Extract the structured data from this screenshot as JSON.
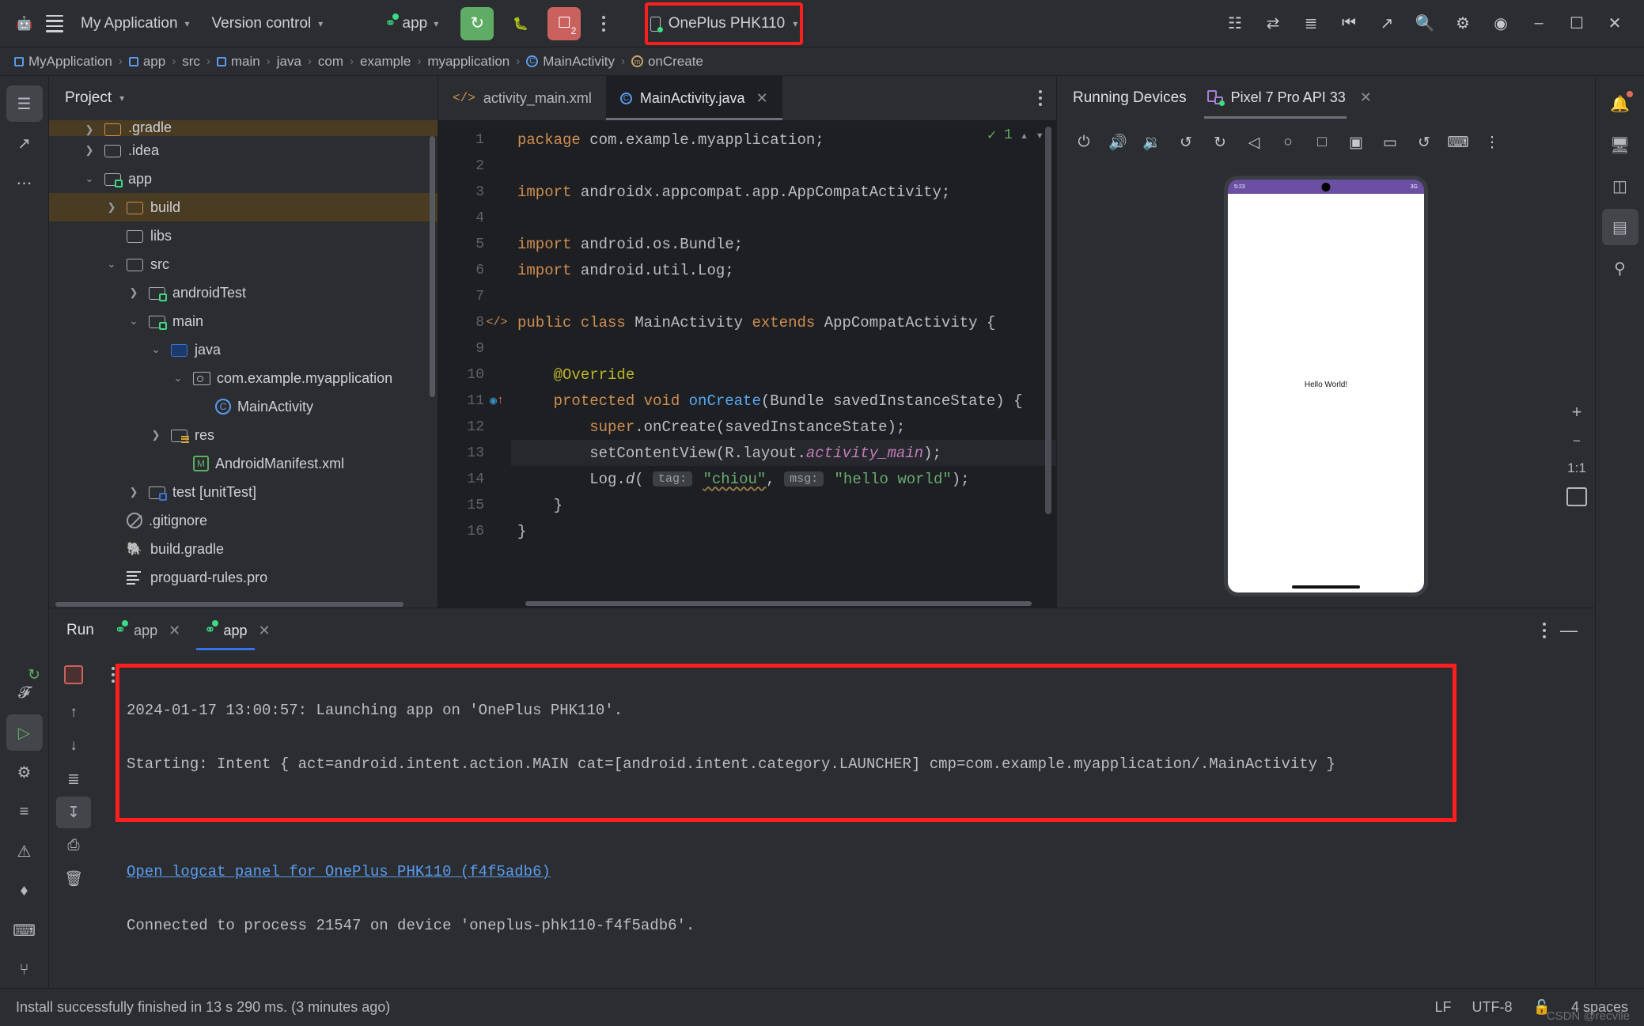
{
  "titlebar": {
    "app_icon": "android-icon",
    "menu_icon": "hamburger-menu-icon",
    "project_menu": "My Application",
    "vcs_menu": "Version control",
    "device_selector": "OnePlus PHK110",
    "run_config": "app",
    "run_button": "run-icon",
    "debug_button": "debug-icon",
    "device_manager_badge": "2",
    "highlight_color": "#ff1f1f",
    "win_minimize": "–",
    "win_maximize": "☐",
    "win_close": "✕"
  },
  "breadcrumb": [
    {
      "label": "MyApplication",
      "icon": "module-icon"
    },
    {
      "label": "app",
      "icon": "module-icon"
    },
    {
      "label": "src",
      "icon": "none"
    },
    {
      "label": "main",
      "icon": "module-icon"
    },
    {
      "label": "java",
      "icon": "none"
    },
    {
      "label": "com",
      "icon": "none"
    },
    {
      "label": "example",
      "icon": "none"
    },
    {
      "label": "myapplication",
      "icon": "none"
    },
    {
      "label": "MainActivity",
      "icon": "class-icon"
    },
    {
      "label": "onCreate",
      "icon": "method-icon"
    }
  ],
  "left_rail": [
    {
      "name": "project-tool-icon",
      "glyph": "☰",
      "selected": true
    },
    {
      "name": "commit-tool-icon",
      "glyph": "⎇",
      "selected": false
    },
    {
      "name": "more-tool-windows-icon",
      "glyph": "⋯",
      "selected": false
    }
  ],
  "project": {
    "title": "Project",
    "dropdown_icon": "chevron-down-icon",
    "tree": [
      {
        "label": ".gradle",
        "indent": 1,
        "arrow": "right",
        "icon": "folder-orange",
        "selected": true,
        "partial": true
      },
      {
        "label": ".idea",
        "indent": 1,
        "arrow": "right",
        "icon": "folder",
        "selected": false
      },
      {
        "label": "app",
        "indent": 1,
        "arrow": "down",
        "icon": "folder-module",
        "selected": false
      },
      {
        "label": "build",
        "indent": 2,
        "arrow": "right",
        "icon": "folder-orange",
        "selected": true
      },
      {
        "label": "libs",
        "indent": 2,
        "arrow": "none",
        "icon": "folder",
        "selected": false
      },
      {
        "label": "src",
        "indent": 2,
        "arrow": "down",
        "icon": "folder",
        "selected": false
      },
      {
        "label": "androidTest",
        "indent": 3,
        "arrow": "right",
        "icon": "folder-module",
        "selected": false
      },
      {
        "label": "main",
        "indent": 3,
        "arrow": "down",
        "icon": "folder-module",
        "selected": false
      },
      {
        "label": "java",
        "indent": 4,
        "arrow": "down",
        "icon": "folder-source",
        "selected": false
      },
      {
        "label": "com.example.myapplication",
        "indent": 5,
        "arrow": "down",
        "icon": "package",
        "selected": false
      },
      {
        "label": "MainActivity",
        "indent": 6,
        "arrow": "none",
        "icon": "class",
        "selected": false
      },
      {
        "label": "res",
        "indent": 4,
        "arrow": "right",
        "icon": "folder-res",
        "selected": false
      },
      {
        "label": "AndroidManifest.xml",
        "indent": 5,
        "arrow": "none",
        "icon": "manifest",
        "selected": false
      },
      {
        "label": "test [unitTest]",
        "indent": 3,
        "arrow": "right",
        "icon": "folder-test",
        "selected": false
      },
      {
        "label": ".gitignore",
        "indent": 2,
        "arrow": "none",
        "icon": "gitignore",
        "selected": false
      },
      {
        "label": "build.gradle",
        "indent": 2,
        "arrow": "none",
        "icon": "gradle",
        "selected": false
      },
      {
        "label": "proguard-rules.pro",
        "indent": 2,
        "arrow": "none",
        "icon": "proguard",
        "selected": false
      }
    ]
  },
  "editor": {
    "tabs": [
      {
        "label": "activity_main.xml",
        "icon": "xml-icon",
        "active": false,
        "closeable": false
      },
      {
        "label": "MainActivity.java",
        "icon": "class-icon",
        "active": true,
        "closeable": true
      }
    ],
    "inspection_count": "1",
    "lines": [
      {
        "n": "1",
        "marker": "",
        "segs": [
          {
            "t": "package ",
            "c": "kw"
          },
          {
            "t": "com.example.myapplication;",
            "c": ""
          }
        ]
      },
      {
        "n": "2",
        "marker": "",
        "segs": []
      },
      {
        "n": "3",
        "marker": "",
        "segs": [
          {
            "t": "import ",
            "c": "kw"
          },
          {
            "t": "androidx.appcompat.app.AppCompatActivity;",
            "c": ""
          }
        ]
      },
      {
        "n": "4",
        "marker": "",
        "segs": []
      },
      {
        "n": "5",
        "marker": "",
        "segs": [
          {
            "t": "import ",
            "c": "kw"
          },
          {
            "t": "android.os.Bundle;",
            "c": ""
          }
        ]
      },
      {
        "n": "6",
        "marker": "",
        "segs": [
          {
            "t": "import ",
            "c": "kw"
          },
          {
            "t": "android.util.Log;",
            "c": ""
          }
        ]
      },
      {
        "n": "7",
        "marker": "",
        "segs": []
      },
      {
        "n": "8",
        "marker": "code",
        "segs": [
          {
            "t": "public class ",
            "c": "kw"
          },
          {
            "t": "MainActivity ",
            "c": ""
          },
          {
            "t": "extends ",
            "c": "kw"
          },
          {
            "t": "AppCompatActivity {",
            "c": ""
          }
        ]
      },
      {
        "n": "9",
        "marker": "",
        "segs": []
      },
      {
        "n": "10",
        "marker": "",
        "segs": [
          {
            "t": "    @Override",
            "c": "ann"
          }
        ]
      },
      {
        "n": "11",
        "marker": "override",
        "segs": [
          {
            "t": "    protected void ",
            "c": "kw"
          },
          {
            "t": "onCreate",
            "c": "fn"
          },
          {
            "t": "(Bundle savedInstanceState) {",
            "c": ""
          }
        ]
      },
      {
        "n": "12",
        "marker": "",
        "segs": [
          {
            "t": "        ",
            "c": ""
          },
          {
            "t": "super",
            "c": "kw"
          },
          {
            "t": ".onCreate(savedInstanceState);",
            "c": ""
          }
        ]
      },
      {
        "n": "13",
        "marker": "",
        "current": true,
        "segs": [
          {
            "t": "        setContentView(R.layout.",
            "c": ""
          },
          {
            "t": "activity_main",
            "c": "fld"
          },
          {
            "t": ");",
            "c": ""
          }
        ]
      },
      {
        "n": "14",
        "marker": "",
        "segs": [
          {
            "t": "        Log.",
            "c": ""
          },
          {
            "t": "d",
            "c": "fldi"
          },
          {
            "t": "( ",
            "c": ""
          },
          {
            "t": "tag:",
            "c": "hint"
          },
          {
            "t": " ",
            "c": ""
          },
          {
            "t": "\"chiou\"",
            "c": "strw"
          },
          {
            "t": ", ",
            "c": ""
          },
          {
            "t": "msg:",
            "c": "hint"
          },
          {
            "t": " ",
            "c": ""
          },
          {
            "t": "\"hello world\"",
            "c": "str"
          },
          {
            "t": ");",
            "c": ""
          }
        ]
      },
      {
        "n": "15",
        "marker": "",
        "segs": [
          {
            "t": "    }",
            "c": ""
          }
        ]
      },
      {
        "n": "16",
        "marker": "",
        "segs": [
          {
            "t": "}",
            "c": ""
          }
        ]
      }
    ]
  },
  "running_devices": {
    "title": "Running Devices",
    "tab": "Pixel 7 Pro API 33",
    "tab_close": "✕",
    "toolbar": [
      {
        "name": "power-icon",
        "glyph": "⏻"
      },
      {
        "name": "volume-up-icon",
        "glyph": "🔊"
      },
      {
        "name": "volume-down-icon",
        "glyph": "🔉"
      },
      {
        "name": "rotate-left-icon",
        "glyph": "↺"
      },
      {
        "name": "rotate-right-icon",
        "glyph": "↻"
      },
      {
        "name": "back-icon",
        "glyph": "◁"
      },
      {
        "name": "home-icon",
        "glyph": "○"
      },
      {
        "name": "overview-icon",
        "glyph": "□"
      },
      {
        "name": "screenshot-icon",
        "glyph": "▣"
      },
      {
        "name": "record-screen-icon",
        "glyph": "▭"
      },
      {
        "name": "back-navigation-icon",
        "glyph": "↺"
      },
      {
        "name": "keyboard-icon",
        "glyph": "⌨"
      },
      {
        "name": "more-options-icon",
        "glyph": "⋮"
      }
    ],
    "screen": {
      "status_left": "5:23",
      "status_right": "3G",
      "content_text": "Hello World!"
    },
    "zoom_controls": [
      {
        "name": "zoom-in-icon",
        "glyph": "+"
      },
      {
        "name": "zoom-out-icon",
        "glyph": "−"
      },
      {
        "name": "zoom-actual-icon",
        "glyph": "1:1"
      },
      {
        "name": "zoom-fit-icon",
        "glyph": "⧉"
      }
    ]
  },
  "run_panel": {
    "title": "Run",
    "tabs": [
      {
        "label": "app",
        "active": false
      },
      {
        "label": "app",
        "active": true
      }
    ],
    "rail": [
      {
        "name": "rerun-icon",
        "glyph": "↻",
        "selected": false
      },
      {
        "name": "stop-icon",
        "glyph": "■",
        "selected": false
      },
      {
        "name": "more-run-options-icon",
        "glyph": "⋮",
        "selected": false
      },
      {
        "name": "scroll-up-icon",
        "glyph": "↑",
        "selected": false
      },
      {
        "name": "scroll-down-icon",
        "glyph": "↓",
        "selected": false
      },
      {
        "name": "soft-wrap-icon",
        "glyph": "≡",
        "selected": false
      },
      {
        "name": "scroll-to-end-icon",
        "glyph": "↧",
        "selected": true
      },
      {
        "name": "print-icon",
        "glyph": "⎙",
        "selected": false
      },
      {
        "name": "clear-all-icon",
        "glyph": "🗑",
        "selected": false
      }
    ],
    "highlight_color": "#ff1f1f",
    "console": {
      "line1": "2024-01-17 13:00:57: Launching app on 'OnePlus PHK110'.",
      "line2": "Starting: Intent { act=android.intent.action.MAIN cat=[android.intent.category.LAUNCHER] cmp=com.example.myapplication/.MainActivity }",
      "line3": "",
      "link": "Open logcat panel for OnePlus PHK110 (f4f5adb6)",
      "line4": "Connected to process 21547 on device 'oneplus-phk110-f4f5adb6'."
    }
  },
  "right_rail": [
    {
      "name": "notifications-icon",
      "glyph": "🔔",
      "selected": false,
      "badge": true
    },
    {
      "name": "gradle-icon",
      "glyph": "🐘",
      "selected": false,
      "badge": false
    },
    {
      "name": "device-manager-icon",
      "glyph": "▧",
      "selected": false,
      "badge": false
    },
    {
      "name": "running-devices-icon",
      "glyph": "▤",
      "selected": true,
      "badge": false
    },
    {
      "name": "device-explorer-icon",
      "glyph": "⌕",
      "selected": false,
      "badge": false
    }
  ],
  "right_toolbar": [
    {
      "name": "project-structure-icon",
      "glyph": "☷"
    },
    {
      "name": "translate-icon",
      "glyph": "文"
    },
    {
      "name": "layout-inspector-icon",
      "glyph": "≣"
    },
    {
      "name": "profiler-icon",
      "glyph": "⌾"
    },
    {
      "name": "app-quality-icon",
      "glyph": "↗"
    },
    {
      "name": "search-icon",
      "glyph": "⚲"
    },
    {
      "name": "settings-icon",
      "glyph": "⚙"
    },
    {
      "name": "account-icon",
      "glyph": "○"
    }
  ],
  "statusbar": {
    "message": "Install successfully finished in 13 s 290 ms. (3 minutes ago)",
    "line_separator": "LF",
    "encoding": "UTF-8",
    "read_only_icon": "lock-open-icon",
    "indent": "4 spaces",
    "watermark": "CSDN @recvlle"
  }
}
